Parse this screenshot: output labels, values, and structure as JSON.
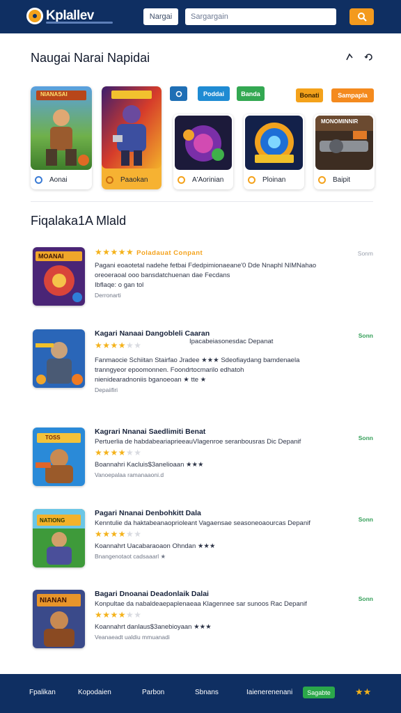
{
  "header": {
    "logo_text": "Kplallev",
    "nav_label": "Nargai",
    "search_placeholder": "Sargargain",
    "search_icon": "search-icon",
    "bg_color": "#0f2f62",
    "accent_color": "#f39a1e"
  },
  "featured": {
    "title": "Naugai Narai Napidai",
    "chips": [
      "Poddai",
      "Banda",
      "Bonati",
      "Sampapla"
    ],
    "cards": [
      {
        "label": "Aonai",
        "banner": "NIANASAI"
      },
      {
        "label": "Paaokan",
        "banner": ""
      },
      {
        "label": "A'Aorinian",
        "banner": ""
      },
      {
        "label": "Ploinan",
        "banner": ""
      },
      {
        "label": "Baipit",
        "banner": "MONOMINNIR"
      }
    ]
  },
  "list": {
    "title": "Fiqalaka1A Mlald",
    "items": [
      {
        "banner": "MOANAI",
        "title": "Poladauat Conpant",
        "rating": 5,
        "desc1": "Pagani eoaotetal nadehe fetbai Fdedpimionaeane'0 Dde Nnaphl NIMNahao",
        "desc2": "oreoeraoal ooo bansdatchuenan dae Fecdans",
        "desc3": "Ibflaqe: o gan tol",
        "sub": "Derronarti",
        "tag": "Sonm"
      },
      {
        "banner": "",
        "title": "Kagari Nanaai Dangobleli Caaran",
        "rating": 3,
        "side": "Ipacabeiasonesdac Depanat",
        "desc1": "Fanmaocie Schiitan Stairfao Jradee ★★★ Sdeofiaydang bamdenaela",
        "desc2": "tranngyeor epoomonnen. Foondrtocmarilo edhatoh",
        "desc3": "nienidearadnoniis bganoeoan ★ tte ★",
        "sub": "Depaiifiri",
        "tag": "Sonn"
      },
      {
        "banner": "TOSS",
        "title": "Kagrari Nnanai Saedlimiti Benat",
        "rating": 3,
        "desc1": "Pertuerlia de habdabeariaprieeauVlagenroe seranbousras Dic Depanif",
        "desc2": "Boannahri Kacluis$3anelioaan ★★★",
        "sub": "Vanoepalaa ramanaaoni.d",
        "tag": "Sonn"
      },
      {
        "banner": "NATIONG",
        "title": "Pagari Nnanai Denbohkitt Dala",
        "rating": 3,
        "desc1": "Kenntulie da haktabeanaoprioleant Vagaensae seasoneoaourcas Depanif",
        "desc2": "Koannahrt Uacabaraoaon Ohndan ★★★",
        "sub": "Bnangenotaot cadsaaarl ★",
        "tag": "Sonn"
      },
      {
        "banner": "NIANAN",
        "title": "Bagari Dnoanai Deadonlaik Dalai",
        "rating": 3,
        "desc1": "Konpultae da nabaldeaepaplenaeaa Klagennee sar sunoos Rac Depanif",
        "desc2": "Koannahrt danlaus$3anebioyaan ★★★",
        "sub": "Veanaeadt ualdiu mmuanadi",
        "tag": "Sonn"
      }
    ]
  },
  "footer": {
    "links": [
      "Fpalikan",
      "Kopodaien",
      "Parbon",
      "Sbnans",
      "Iaienerenenani"
    ],
    "green_label": "Sagabte",
    "stars": "★★"
  }
}
